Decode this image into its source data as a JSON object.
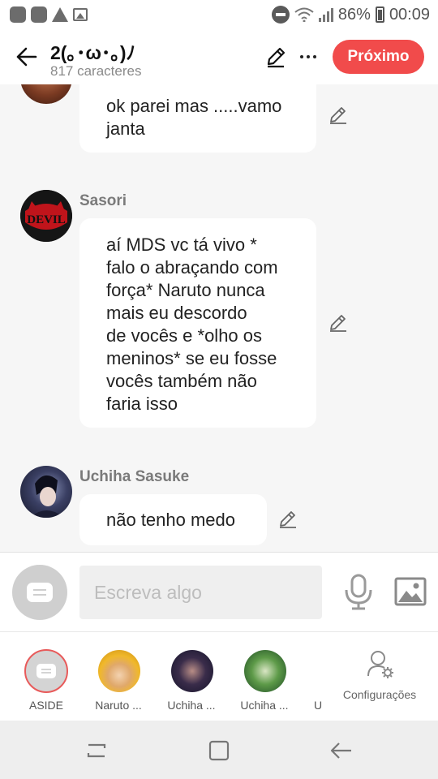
{
  "status_bar": {
    "battery": "86%",
    "time": "00:09",
    "icons": [
      "app-icon",
      "app-icon",
      "warning-icon",
      "image-icon",
      "dnd-icon",
      "wifi-icon",
      "signal-icon",
      "battery-icon"
    ]
  },
  "header": {
    "title": "2(｡･ω･｡)ﾉ",
    "subtitle": "817 caracteres",
    "next_label": "Próximo",
    "icons": [
      "back-arrow-icon",
      "pencil-icon",
      "more-icon"
    ]
  },
  "messages": [
    {
      "sender": "",
      "lines": [
        "ok parei mas .....vamo",
        "janta"
      ]
    },
    {
      "sender": "Sasori",
      "avatar_text": "DEVIL",
      "lines": [
        "aí MDS vc tá vivo *",
        "falo o abraçando com",
        "força* Naruto nunca",
        "mais eu descordo",
        "de vocês e *olho os",
        "meninos* se eu fosse",
        "vocês também não",
        "faria isso"
      ]
    },
    {
      "sender": "Uchiha Sasuke",
      "lines": [
        "não tenho medo"
      ]
    }
  ],
  "input": {
    "placeholder": "Escreva algo"
  },
  "characters": [
    {
      "label": "ASIDE"
    },
    {
      "label": "Naruto ..."
    },
    {
      "label": "Uchiha ..."
    },
    {
      "label": "Uchiha ..."
    },
    {
      "label": "U"
    }
  ],
  "settings_label": "Configurações",
  "colors": {
    "accent": "#f14b4b",
    "background": "#f6f6f6",
    "bubble": "#ffffff",
    "sender": "#7a7a7a"
  }
}
